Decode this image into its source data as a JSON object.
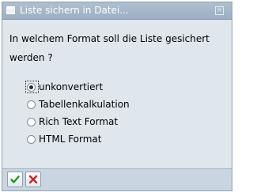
{
  "dialog": {
    "title": "Liste sichern in Datei...",
    "question": "In welchem Format soll die Liste gesichert werden ?",
    "options": [
      {
        "label": "unkonvertiert",
        "checked": true
      },
      {
        "label": "Tabellenkalkulation",
        "checked": false
      },
      {
        "label": "Rich Text Format",
        "checked": false
      },
      {
        "label": "HTML Format",
        "checked": false
      }
    ]
  },
  "icons": {
    "title": "window-icon",
    "close": "close-icon",
    "confirm": "checkmark-icon",
    "cancel": "cross-icon"
  },
  "colors": {
    "confirm": "#1f9a1f",
    "cancel": "#d42020"
  }
}
